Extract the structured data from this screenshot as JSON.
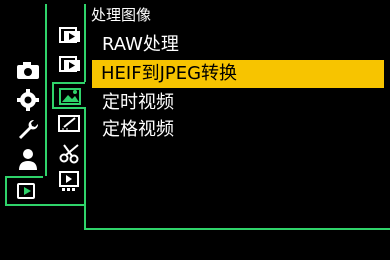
{
  "menu": {
    "title": "处理图像",
    "items": [
      {
        "label": "RAW处理",
        "selected": false
      },
      {
        "label": "HEIF到JPEG转换",
        "selected": true
      },
      {
        "label": "定时视频",
        "selected": false
      },
      {
        "label": "定格视频",
        "selected": false
      }
    ]
  },
  "main_categories": [
    "camera-icon",
    "gear-icon",
    "wrench-icon",
    "person-icon",
    "playback-icon"
  ],
  "active_main_category": "playback-icon",
  "sub_tabs": [
    "playback-tab-1-icon",
    "playback-tab-2-icon",
    "image-processing-icon",
    "edit-icon",
    "scissors-icon",
    "slideshow-icon"
  ],
  "active_sub_tab": "image-processing-icon",
  "colors": {
    "accent": "#2fd36a",
    "highlight": "#f7c400",
    "background": "#000000"
  }
}
